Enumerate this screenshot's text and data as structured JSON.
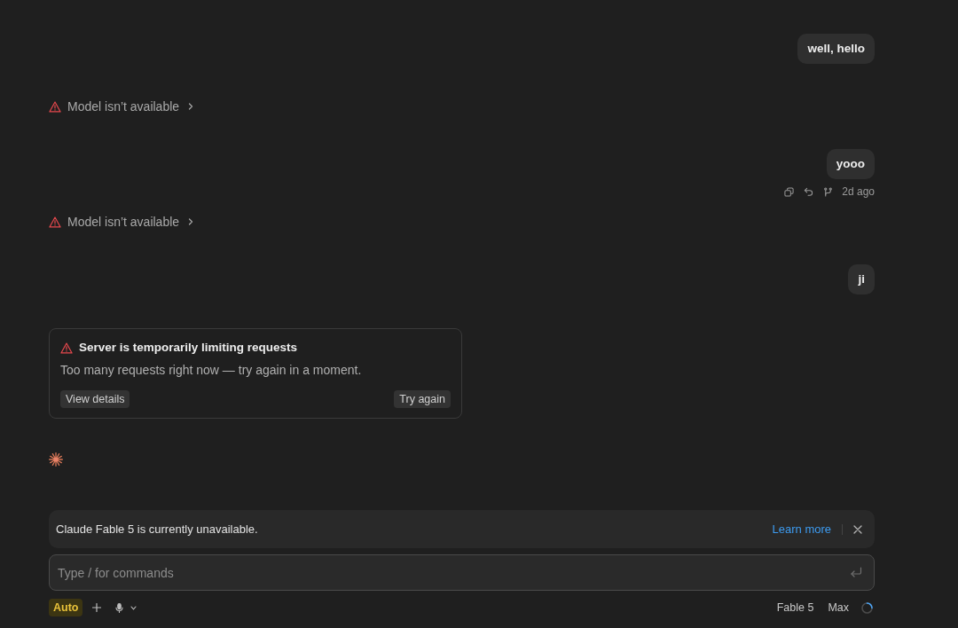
{
  "conversation": [
    {
      "kind": "user_message",
      "text": "well, hello"
    },
    {
      "kind": "model_error",
      "text": "Model isn’t available"
    },
    {
      "kind": "user_message",
      "text": "yooo",
      "timestamp": "2d ago"
    },
    {
      "kind": "model_error",
      "text": "Model isn’t available"
    },
    {
      "kind": "user_message",
      "text": "ji"
    },
    {
      "kind": "error_card",
      "title": "Server is temporarily limiting requests",
      "message": "Too many requests right now — try again in a moment.",
      "buttons": [
        "View details",
        "Try again"
      ]
    },
    {
      "kind": "thinking"
    }
  ],
  "notice_banner": {
    "text": "Claude Fable 5 is currently unavailable.",
    "link": "Learn more"
  },
  "composer": {
    "placeholder": "Type / for commands"
  },
  "toolbar": {
    "mode": "Auto",
    "model": "Fable 5",
    "effort": "Max"
  }
}
